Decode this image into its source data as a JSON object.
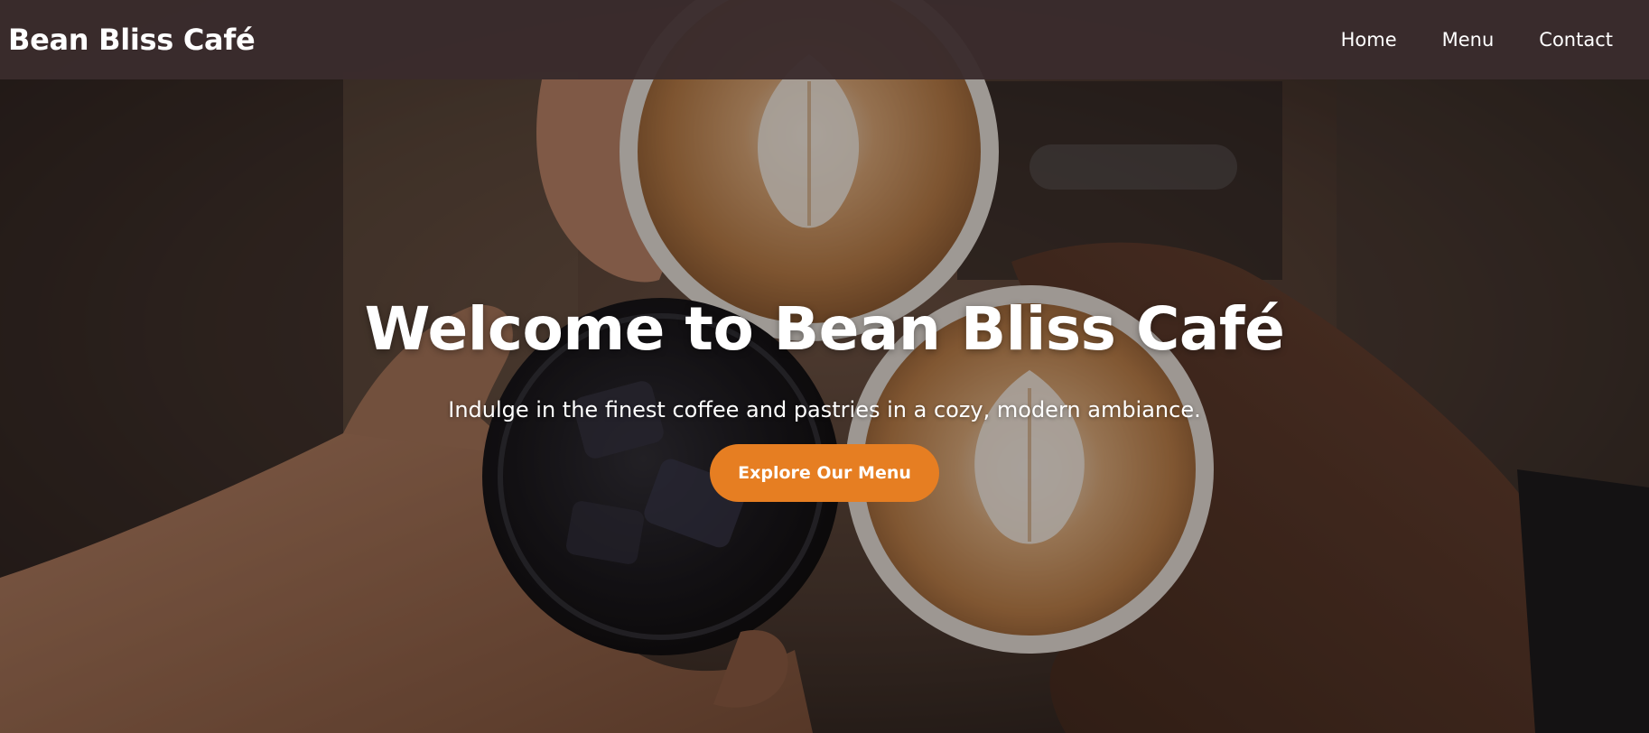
{
  "navbar": {
    "brand": "Bean Bliss Café",
    "links": [
      {
        "label": "Home"
      },
      {
        "label": "Menu"
      },
      {
        "label": "Contact"
      }
    ]
  },
  "hero": {
    "title": "Welcome to Bean Bliss Café",
    "subtitle": "Indulge in the finest coffee and pastries in a cozy, modern ambiance.",
    "cta_label": "Explore Our Menu"
  },
  "colors": {
    "navbar_bg": "#3a2c2d",
    "accent": "#e67e22",
    "text": "#ffffff"
  }
}
